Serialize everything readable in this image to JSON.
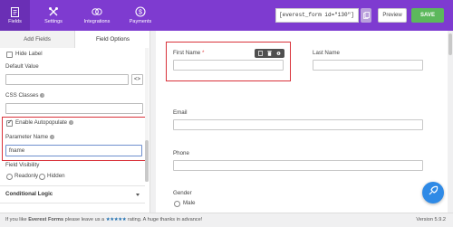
{
  "topnav": {
    "items": [
      {
        "label": "Fields",
        "icon": "fields-icon"
      },
      {
        "label": "Settings",
        "icon": "settings-icon"
      },
      {
        "label": "Integrations",
        "icon": "integrations-icon"
      },
      {
        "label": "Payments",
        "icon": "payments-icon"
      }
    ],
    "shortcode": "[everest_form id=\"130\"]",
    "preview_label": "Preview",
    "save_label": "SAVE",
    "accent_color": "#7e3bd0"
  },
  "sidebar": {
    "tabs": [
      {
        "label": "Add Fields"
      },
      {
        "label": "Field Options"
      }
    ],
    "hide_label": "Hide Label",
    "default_value_label": "Default Value",
    "default_value": "",
    "css_classes_label": "CSS Classes",
    "css_classes_value": "",
    "enable_autopopulate_label": "Enable Autopopulate",
    "enable_autopopulate_checked": true,
    "parameter_name_label": "Parameter Name",
    "parameter_name_value": "fname",
    "field_visibility_label": "Field Visibility",
    "visibility_options": [
      "Readonly",
      "Hidden"
    ],
    "conditional_logic_label": "Conditional Logic"
  },
  "canvas": {
    "first_name_label": "First Name",
    "last_name_label": "Last Name",
    "email_label": "Email",
    "phone_label": "Phone",
    "gender_label": "Gender",
    "gender_option": "Male",
    "required_mark": "*"
  },
  "footer": {
    "text_before": "If you like ",
    "brand": "Everest Forms",
    "text_middle": " please leave us a ",
    "stars": "★★★★★",
    "text_after": " rating. A huge thanks in advance!",
    "version": "Version 5.9.2"
  }
}
